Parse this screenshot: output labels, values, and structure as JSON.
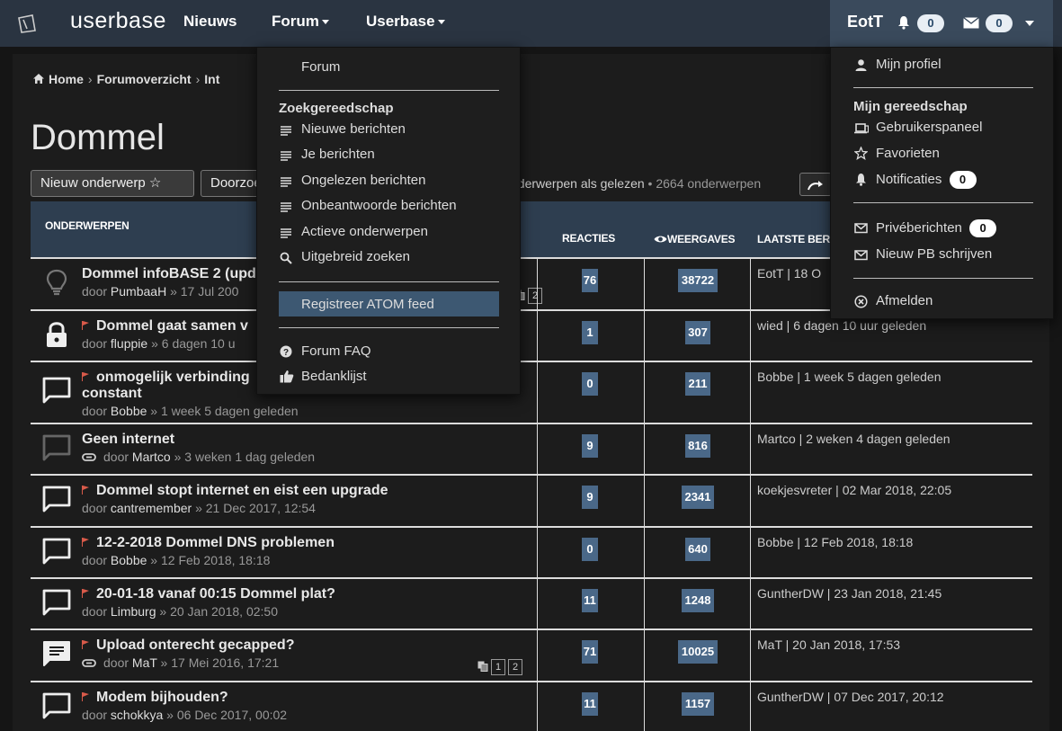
{
  "nav": {
    "logo": "userbase",
    "items": [
      {
        "label": "Nieuws"
      },
      {
        "label": "Forum"
      },
      {
        "label": "Userbase"
      }
    ],
    "user": "EotT",
    "notifications_count": "0",
    "messages_count": "0"
  },
  "breadcrumb": [
    "Home",
    "Forumoverzicht",
    "Int"
  ],
  "page": {
    "title": "Dommel",
    "new_topic_button": "Nieuw onderwerp ☆",
    "search_button": "Doorzoek",
    "mark_read": "nderwerpen als gelezen",
    "topic_count": "2664 onderwerpen"
  },
  "table": {
    "headers": {
      "topics": "ONDERWERPEN",
      "replies": "REACTIES",
      "views": "WEERGAVES",
      "last_post": "LAATSTE BER"
    },
    "rows": [
      {
        "title": "Dommel infoBASE 2 (upd",
        "author": "PumbaaH",
        "date": "17 Jul 200",
        "replies": "76",
        "views": "38722",
        "last_author": "EotT",
        "last_date": "18 O",
        "icon": "lightbulb-icon",
        "flag": false,
        "pages": [
          "2"
        ]
      },
      {
        "title": "Dommel gaat samen v",
        "author": "fluppie",
        "date": "6 dagen 10 u",
        "replies": "1",
        "views": "307",
        "last_author": "wied",
        "last_date": "6 dagen 10 uur geleden",
        "icon": "lock-icon",
        "flag": true,
        "pages": []
      },
      {
        "title": "onmogelijk verbinding",
        "title2": "constant",
        "author": "Bobbe",
        "date": "1 week 5 dagen geleden",
        "replies": "0",
        "views": "211",
        "last_author": "Bobbe",
        "last_date": "1 week 5 dagen geleden",
        "icon": "chat-bubble-icon",
        "flag": true,
        "pages": []
      },
      {
        "title": "Geen internet",
        "author": "Martco",
        "date": "3 weken 1 dag geleden",
        "replies": "9",
        "views": "816",
        "last_author": "Martco",
        "last_date": "2 weken 4 dagen geleden",
        "icon": "chat-bubble-icon",
        "flag": false,
        "attachment": true,
        "pages": []
      },
      {
        "title": "Dommel stopt internet en eist een upgrade",
        "author": "cantremember",
        "date": "21 Dec 2017, 12:54",
        "replies": "9",
        "views": "2341",
        "last_author": "koekjesvreter",
        "last_date": "02 Mar 2018, 22:05",
        "icon": "chat-bubble-icon",
        "flag": true,
        "pages": []
      },
      {
        "title": "12-2-2018 Dommel DNS problemen",
        "author": "Bobbe",
        "date": "12 Feb 2018, 18:18",
        "replies": "0",
        "views": "640",
        "last_author": "Bobbe",
        "last_date": "12 Feb 2018, 18:18",
        "icon": "chat-bubble-icon",
        "flag": true,
        "pages": []
      },
      {
        "title": "20-01-18 vanaf 00:15 Dommel plat?",
        "author": "Limburg",
        "date": "20 Jan 2018, 02:50",
        "replies": "11",
        "views": "1248",
        "last_author": "GuntherDW",
        "last_date": "23 Jan 2018, 21:45",
        "icon": "chat-bubble-icon",
        "flag": true,
        "pages": []
      },
      {
        "title": "Upload onterecht gecapped?",
        "author": "MaT",
        "date": "17 Mei 2016, 17:21",
        "replies": "71",
        "views": "10025",
        "last_author": "MaT",
        "last_date": "20 Jan 2018, 17:53",
        "icon": "chat-filled-icon",
        "flag": true,
        "attachment": true,
        "pages": [
          "1",
          "2"
        ]
      },
      {
        "title": "Modem bijhouden?",
        "author": "schokkya",
        "date": "06 Dec 2017, 00:02",
        "replies": "11",
        "views": "1157",
        "last_author": "GuntherDW",
        "last_date": "07 Dec 2017, 20:12",
        "icon": "chat-bubble-icon",
        "flag": true,
        "pages": []
      }
    ],
    "by": "door"
  },
  "forum_menu": {
    "top": "Forum",
    "search_heading": "Zoekgereedschap",
    "items": [
      "Nieuwe berichten",
      "Je berichten",
      "Ongelezen berichten",
      "Onbeantwoorde berichten",
      "Actieve onderwerpen",
      "Uitgebreid zoeken"
    ],
    "atom": "Registreer ATOM feed",
    "faq": "Forum FAQ",
    "thanks": "Bedanklijst"
  },
  "user_menu": {
    "profile": "Mijn profiel",
    "tools_heading": "Mijn gereedschap",
    "control_panel": "Gebruikerspaneel",
    "favorites": "Favorieten",
    "notifications": "Notificaties",
    "notifications_count": "0",
    "private_messages": "Privéberichten",
    "pm_count": "0",
    "new_pm": "Nieuw PB schrijven",
    "logout": "Afmelden"
  },
  "colors": {
    "nav_bg": "#2a3441",
    "user_bg": "#3a4a5c",
    "table_header": "#2e3e50",
    "tag": "#4a6888",
    "highlight": "#3d5872"
  }
}
